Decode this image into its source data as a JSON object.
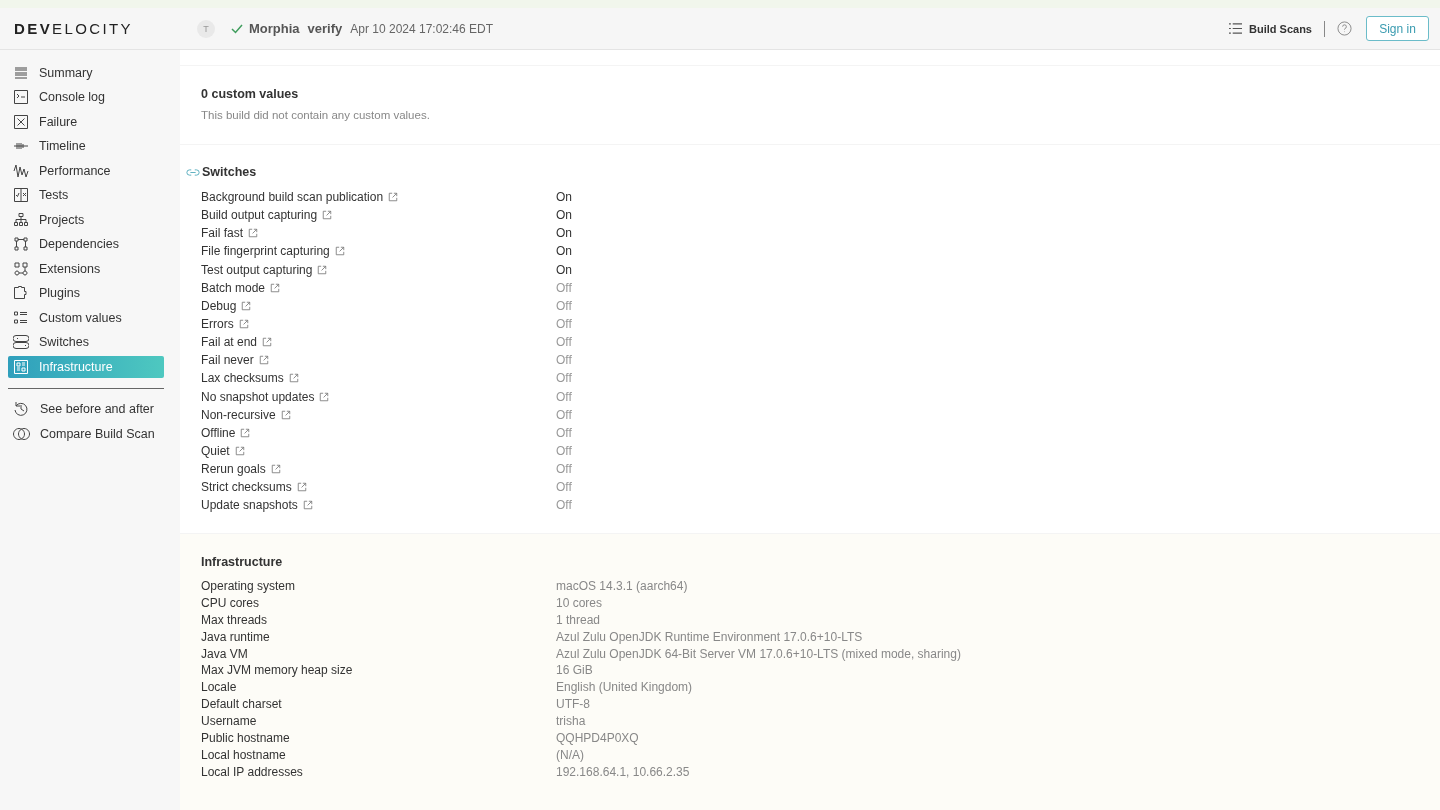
{
  "header": {
    "logo": "**DEV**ELOCITY",
    "avatar": "T",
    "project": "Morphia",
    "task": "verify",
    "date": "Apr 10 2024 17:02:46 EDT",
    "build_scans": "Build Scans",
    "sign_in": "Sign in"
  },
  "sidebar": {
    "items": [
      {
        "label": "Summary",
        "selected": false
      },
      {
        "label": "Console log",
        "selected": false
      },
      {
        "label": "Failure",
        "selected": false
      },
      {
        "label": "Timeline",
        "selected": false
      },
      {
        "label": "Performance",
        "selected": false
      },
      {
        "label": "Tests",
        "selected": false
      },
      {
        "label": "Projects",
        "selected": false
      },
      {
        "label": "Dependencies",
        "selected": false
      },
      {
        "label": "Extensions",
        "selected": false
      },
      {
        "label": "Plugins",
        "selected": false
      },
      {
        "label": "Custom values",
        "selected": false
      },
      {
        "label": "Switches",
        "selected": false
      },
      {
        "label": "Infrastructure",
        "selected": true
      }
    ],
    "extra_items": [
      {
        "label": "See before and after"
      },
      {
        "label": "Compare Build Scan"
      }
    ]
  },
  "custom_values": {
    "title": "0 custom values",
    "message": "This build did not contain any custom values."
  },
  "switches": {
    "title": "Switches",
    "rows": [
      {
        "label": "Background build scan publication",
        "value": "On",
        "on": true
      },
      {
        "label": "Build output capturing",
        "value": "On",
        "on": true
      },
      {
        "label": "Fail fast",
        "value": "On",
        "on": true
      },
      {
        "label": "File fingerprint capturing",
        "value": "On",
        "on": true
      },
      {
        "label": "Test output capturing",
        "value": "On",
        "on": true
      },
      {
        "label": "Batch mode",
        "value": "Off",
        "on": false
      },
      {
        "label": "Debug",
        "value": "Off",
        "on": false
      },
      {
        "label": "Errors",
        "value": "Off",
        "on": false
      },
      {
        "label": "Fail at end",
        "value": "Off",
        "on": false
      },
      {
        "label": "Fail never",
        "value": "Off",
        "on": false
      },
      {
        "label": "Lax checksums",
        "value": "Off",
        "on": false
      },
      {
        "label": "No snapshot updates",
        "value": "Off",
        "on": false
      },
      {
        "label": "Non-recursive",
        "value": "Off",
        "on": false
      },
      {
        "label": "Offline",
        "value": "Off",
        "on": false
      },
      {
        "label": "Quiet",
        "value": "Off",
        "on": false
      },
      {
        "label": "Rerun goals",
        "value": "Off",
        "on": false
      },
      {
        "label": "Strict checksums",
        "value": "Off",
        "on": false
      },
      {
        "label": "Update snapshots",
        "value": "Off",
        "on": false
      }
    ]
  },
  "infrastructure": {
    "title": "Infrastructure",
    "rows": [
      {
        "label": "Operating system",
        "value": "macOS 14.3.1 (aarch64)"
      },
      {
        "label": "CPU cores",
        "value": "10 cores"
      },
      {
        "label": "Max threads",
        "value": "1 thread"
      },
      {
        "label": "Java runtime",
        "value": "Azul Zulu OpenJDK Runtime Environment 17.0.6+10-LTS"
      },
      {
        "label": "Java VM",
        "value": "Azul Zulu OpenJDK 64-Bit Server VM 17.0.6+10-LTS (mixed mode, sharing)"
      },
      {
        "label": "Max JVM memory heap size",
        "value": "16 GiB"
      },
      {
        "label": "Locale",
        "value": "English (United Kingdom)"
      },
      {
        "label": "Default charset",
        "value": "UTF-8"
      },
      {
        "label": "Username",
        "value": "trisha"
      },
      {
        "label": "Public hostname",
        "value": "QQHPD4P0XQ"
      },
      {
        "label": "Local hostname",
        "value": "(N/A)"
      },
      {
        "label": "Local IP addresses",
        "value": "192.168.64.1, 10.66.2.35"
      }
    ]
  }
}
